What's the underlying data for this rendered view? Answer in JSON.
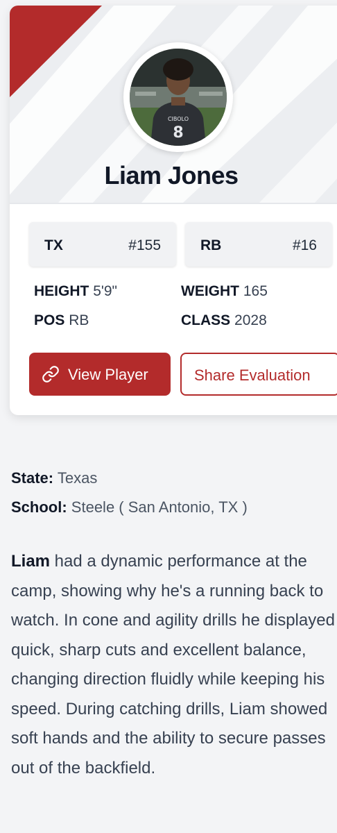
{
  "player": {
    "name": "Liam Jones",
    "state_abbr": "TX",
    "state_rank": "#155",
    "position_abbr": "RB",
    "position_rank": "#16",
    "height_label": "HEIGHT",
    "height": "5'9\"",
    "weight_label": "WEIGHT",
    "weight": "165",
    "pos_label": "POS",
    "pos": "RB",
    "class_label": "CLASS",
    "class_year": "2028",
    "jersey_text": "CIBOLO",
    "jersey_number": "8"
  },
  "actions": {
    "view_label": "View Player",
    "share_label": "Share Evaluation"
  },
  "details": {
    "state_label": "State:",
    "state_value": "Texas",
    "school_label": "School:",
    "school_value": "Steele ( San Antonio, TX )"
  },
  "bio": {
    "name": "Liam",
    "text": " had a dynamic performance at the camp, showing why he's a running back to watch. In cone and agility drills he displayed quick, sharp cuts and excellent balance, changing direction fluidly while keeping his speed. During catching drills, Liam showed soft hands and the ability to secure passes out of the backfield."
  },
  "colors": {
    "accent": "#b32b2b",
    "background": "#f3f4f6",
    "card": "#ffffff"
  },
  "icons": {
    "view_button": "link-icon"
  }
}
